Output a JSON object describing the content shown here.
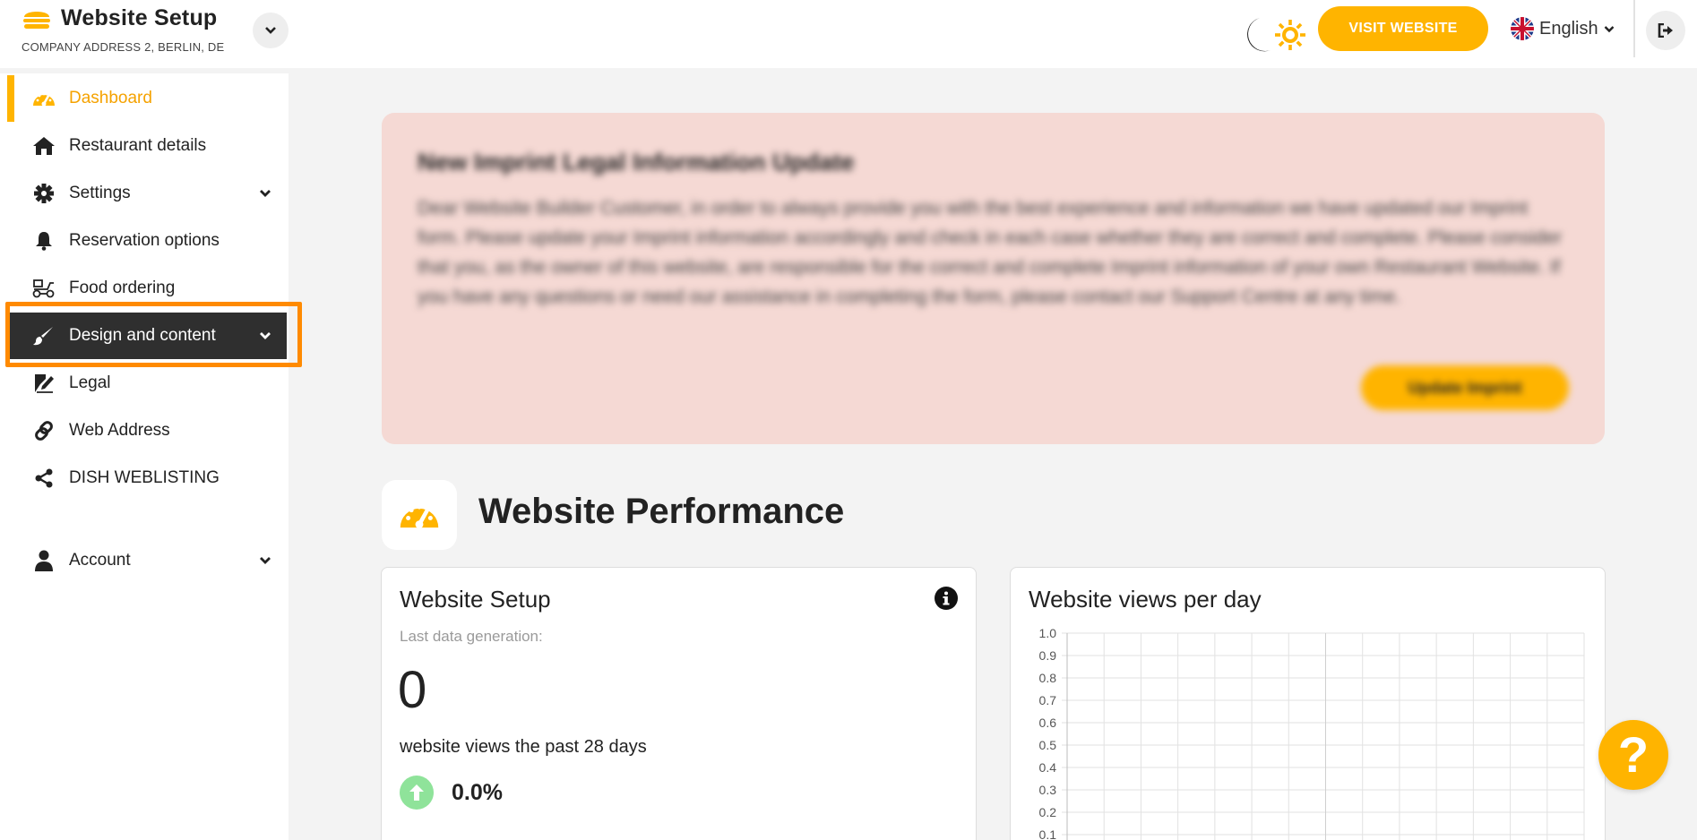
{
  "header": {
    "title": "Website Setup",
    "address": "COMPANY ADDRESS 2, BERLIN, DE",
    "visit_label": "VISIT WEBSITE",
    "language": "English"
  },
  "sidebar": {
    "items": [
      {
        "label": "Dashboard",
        "icon": "gauge-icon"
      },
      {
        "label": "Restaurant details",
        "icon": "home-icon"
      },
      {
        "label": "Settings",
        "icon": "gear-icon"
      },
      {
        "label": "Reservation options",
        "icon": "bell-icon"
      },
      {
        "label": "Food ordering",
        "icon": "scooter-icon"
      },
      {
        "label": "Design and content",
        "icon": "brush-icon"
      },
      {
        "label": "Legal",
        "icon": "signature-icon"
      },
      {
        "label": "Web Address",
        "icon": "link-icon"
      },
      {
        "label": "DISH WEBLISTING",
        "icon": "share-icon"
      },
      {
        "label": "Account",
        "icon": "user-icon"
      }
    ]
  },
  "notice": {
    "title": "New Imprint Legal Information Update",
    "body": "Dear Website Builder Customer, in order to always provide you with the best experience and information we have updated our Imprint form. Please update your Imprint information accordingly and check in each case whether they are correct and complete. Please consider that you, as the owner of this website, are responsible for the correct and complete Imprint information of your own Restaurant Website. If you have any questions or need our assistance in completing the form, please contact our Support Centre at any time.",
    "button": "Update Imprint"
  },
  "performance": {
    "title": "Website Performance"
  },
  "card_setup": {
    "title": "Website Setup",
    "subtitle": "Last data generation:",
    "value": "0",
    "views_text": "website views the past 28 days",
    "change": "0.0%"
  },
  "card_views": {
    "title": "Website views per day"
  },
  "chart_data": {
    "type": "line",
    "title": "Website views per day",
    "ylim": [
      0,
      1.0
    ],
    "y_ticks": [
      "1.0",
      "0.9",
      "0.8",
      "0.7",
      "0.6",
      "0.5",
      "0.4",
      "0.3",
      "0.2",
      "0.1"
    ],
    "series": [],
    "grid": true
  },
  "colors": {
    "accent": "#ffb400",
    "notice_bg": "#f5d9d4",
    "highlight": "#ff8a00",
    "active_dark": "#2f2f2f"
  }
}
